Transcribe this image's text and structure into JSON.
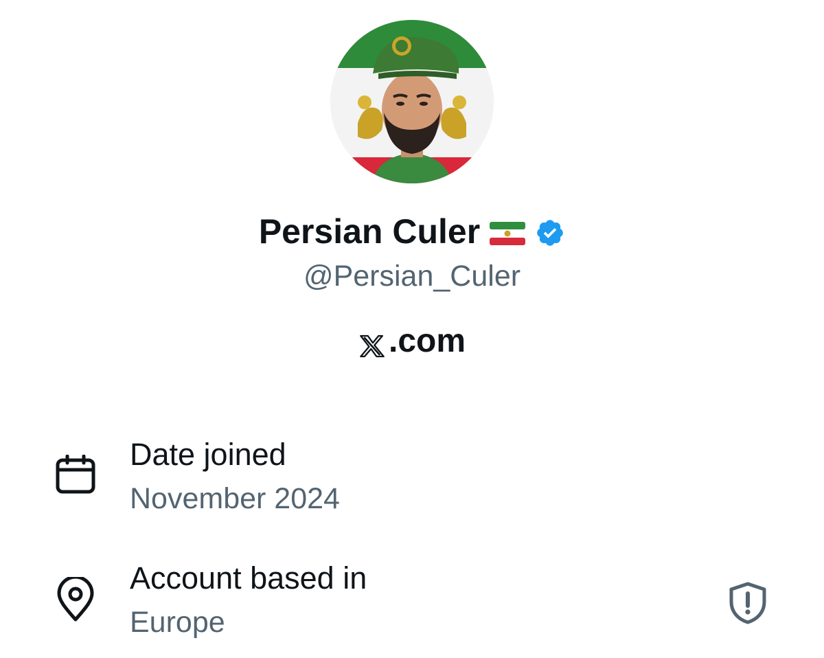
{
  "profile": {
    "display_name": "Persian Culer",
    "name_emoji": "🇮🇷",
    "verified": true,
    "handle": "@Persian_Culer",
    "source_site": ".com",
    "source_logo": "x-logo"
  },
  "details": {
    "joined_label": "Date joined",
    "joined_value": "November 2024",
    "location_label": "Account based in",
    "location_value": "Europe"
  },
  "icons": {
    "calendar": "calendar-icon",
    "location": "location-pin-icon",
    "shield": "shield-alert-icon",
    "verified": "verified-badge-icon"
  },
  "colors": {
    "text_primary": "#0f1419",
    "text_secondary": "#536471",
    "verified_blue": "#1d9bf0"
  }
}
